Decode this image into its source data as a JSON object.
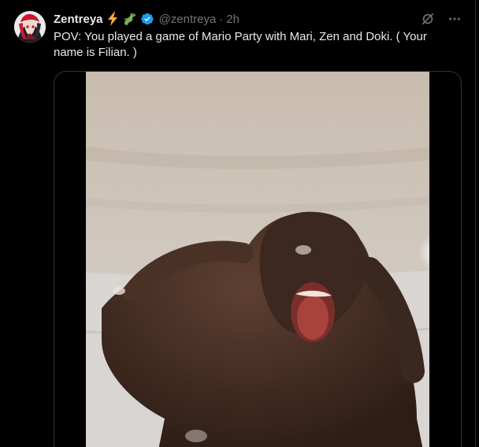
{
  "tweet": {
    "display_name": "Zentreya",
    "name_emojis": [
      "lightning-emoji",
      "dragon-emoji"
    ],
    "verified": true,
    "handle": "@zentreya",
    "separator": "·",
    "time": "2h",
    "text": "POV: You played a game of Mario Party with Mari, Zen and Doki. ( Your\nname is Filian. )"
  },
  "colors": {
    "background": "#000000",
    "primary_text": "#e7e9ea",
    "secondary_text": "#71767b",
    "border": "#2f3336",
    "verified": "#1d9bf0",
    "lightning": "#ffac33",
    "dragon": "#77b255"
  },
  "icons": {
    "grok": "grok-icon",
    "more": "more-icon"
  }
}
